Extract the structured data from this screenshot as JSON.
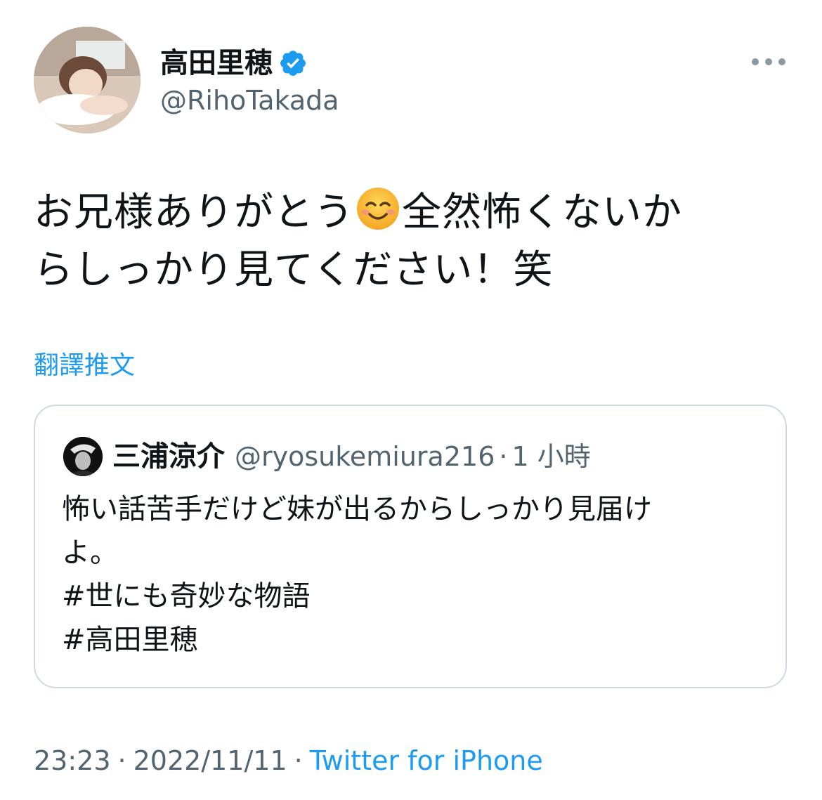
{
  "author": {
    "display_name": "高田里穂",
    "handle": "@RihoTakada",
    "verified": true,
    "verified_icon": "verified-badge-icon"
  },
  "more_icon": "more-horizontal-icon",
  "tweet": {
    "text_before_emoji": "お兄様ありがとう",
    "emoji": "smiling-face-icon",
    "text_after_emoji": "全然怖くないか\nらしっかり見てください！笑"
  },
  "translate_label": "翻譯推文",
  "quote": {
    "display_name": "三浦涼介",
    "handle": "@ryosukemiura216",
    "separator": "·",
    "time": "1 小時",
    "lines": [
      "怖い話苦手だけど妹が出るからしっかり見届け",
      "よ。",
      "#世にも奇妙な物語",
      "#高田里穂"
    ]
  },
  "footer": {
    "time": "23:23",
    "separator": "·",
    "date": "2022/11/11",
    "source": "Twitter for iPhone"
  },
  "colors": {
    "link": "#1d9bf0",
    "secondary_text": "#536471",
    "primary_text": "#0f1419",
    "border": "#cfd9de"
  }
}
